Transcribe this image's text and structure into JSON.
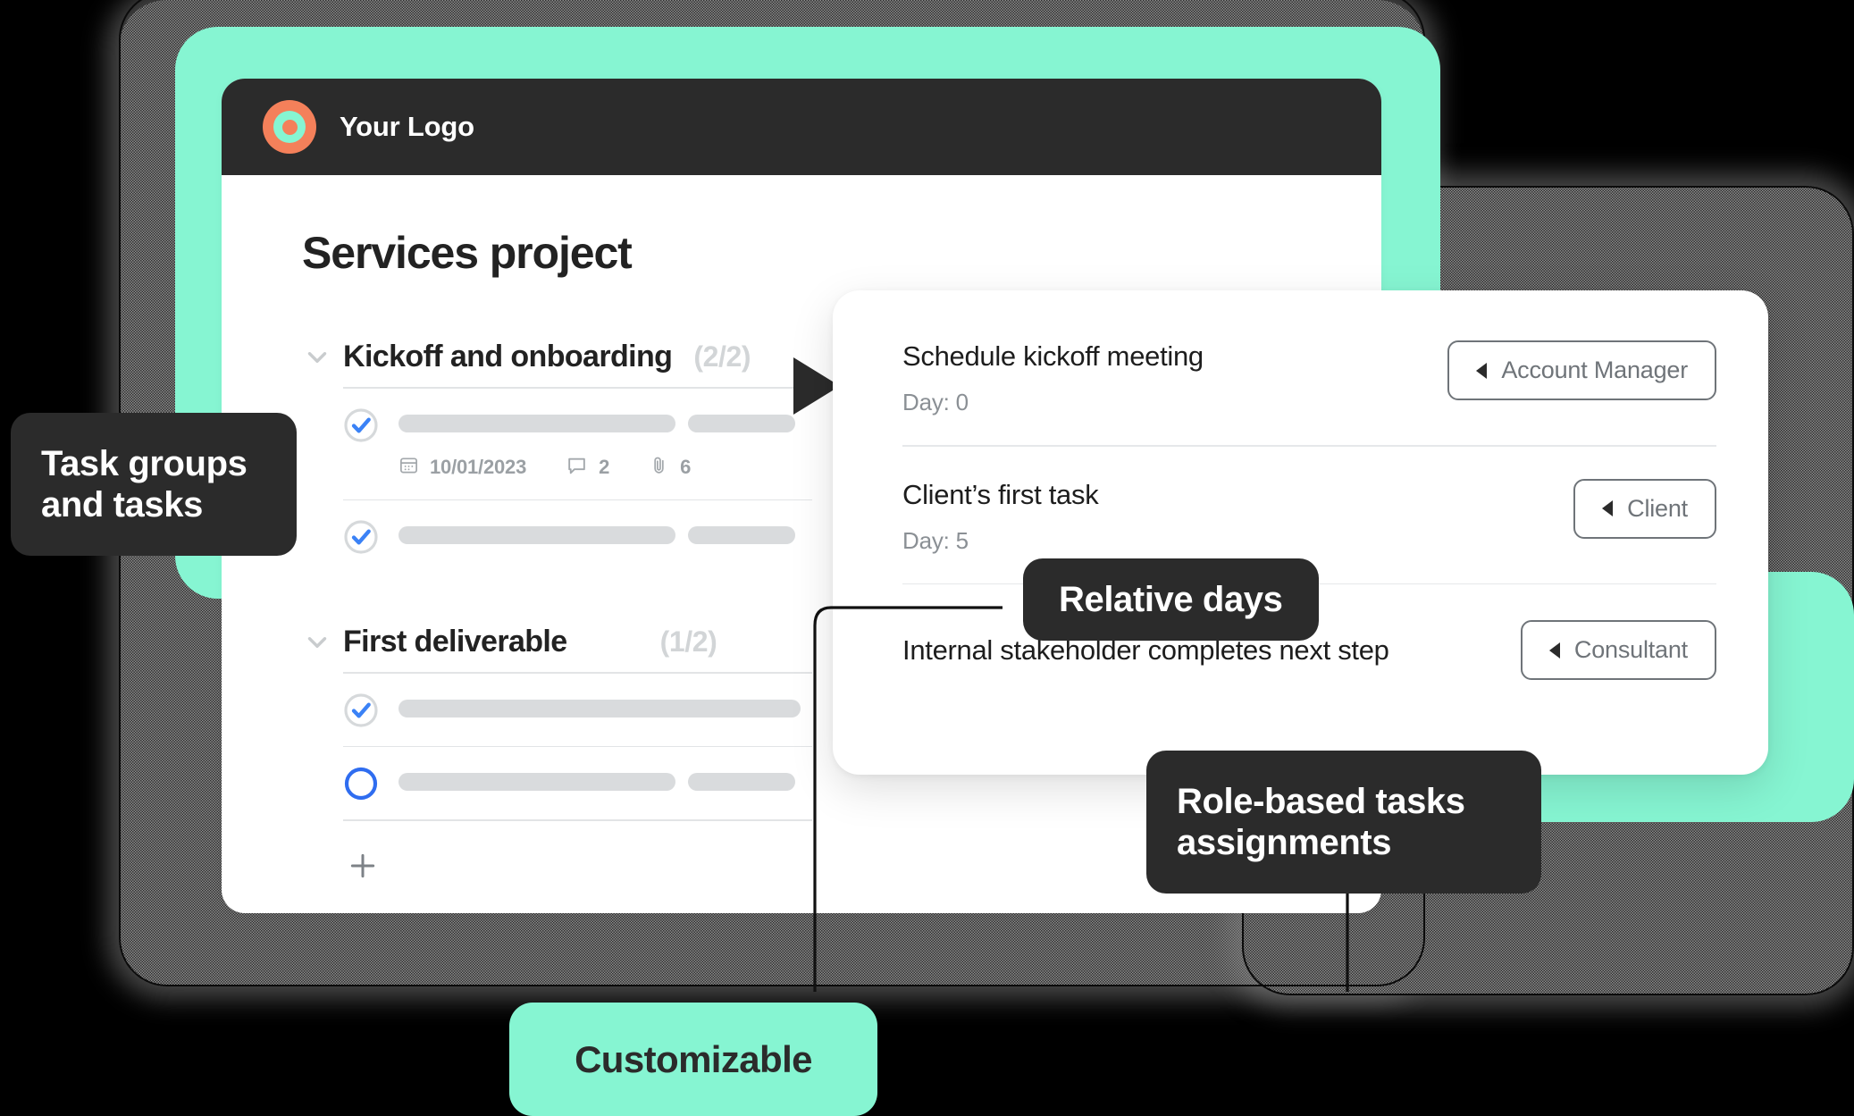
{
  "colors": {
    "mint": "#86F5D2",
    "dark": "#2b2b2b",
    "orange": "#F4805A",
    "blue": "#3b82f6",
    "bar_gray": "#d9dbdd"
  },
  "app": {
    "logo_text": "Your Logo",
    "project_title": "Services project",
    "groups": [
      {
        "title": "Kickoff and onboarding",
        "count": "(2/2)",
        "tasks": [
          {
            "state": "checked",
            "bars": [
              310,
              120
            ],
            "meta": {
              "date": "10/01/2023",
              "comments": "2",
              "attachments": "6"
            }
          },
          {
            "state": "checked",
            "bars": [
              310,
              120
            ],
            "meta": null
          }
        ]
      },
      {
        "title": "First deliverable",
        "count": "(1/2)",
        "tasks": [
          {
            "state": "checked",
            "bars": [
              450
            ],
            "meta": null
          },
          {
            "state": "unchecked",
            "bars": [
              310,
              120
            ],
            "meta": null
          }
        ],
        "add_label": "+"
      }
    ]
  },
  "detail": {
    "rows": [
      {
        "title": "Schedule kickoff meeting",
        "day": "Day: 0",
        "role": "Account Manager"
      },
      {
        "title": "Client’s first task",
        "day": "Day: 5",
        "role": "Client"
      },
      {
        "title": "Internal stakeholder completes next step",
        "day": "",
        "role": "Consultant"
      }
    ]
  },
  "callouts": {
    "task_groups": "Task groups and tasks",
    "relative_days": "Relative days",
    "role_based": "Role-based tasks assignments",
    "customizable": "Customizable"
  }
}
